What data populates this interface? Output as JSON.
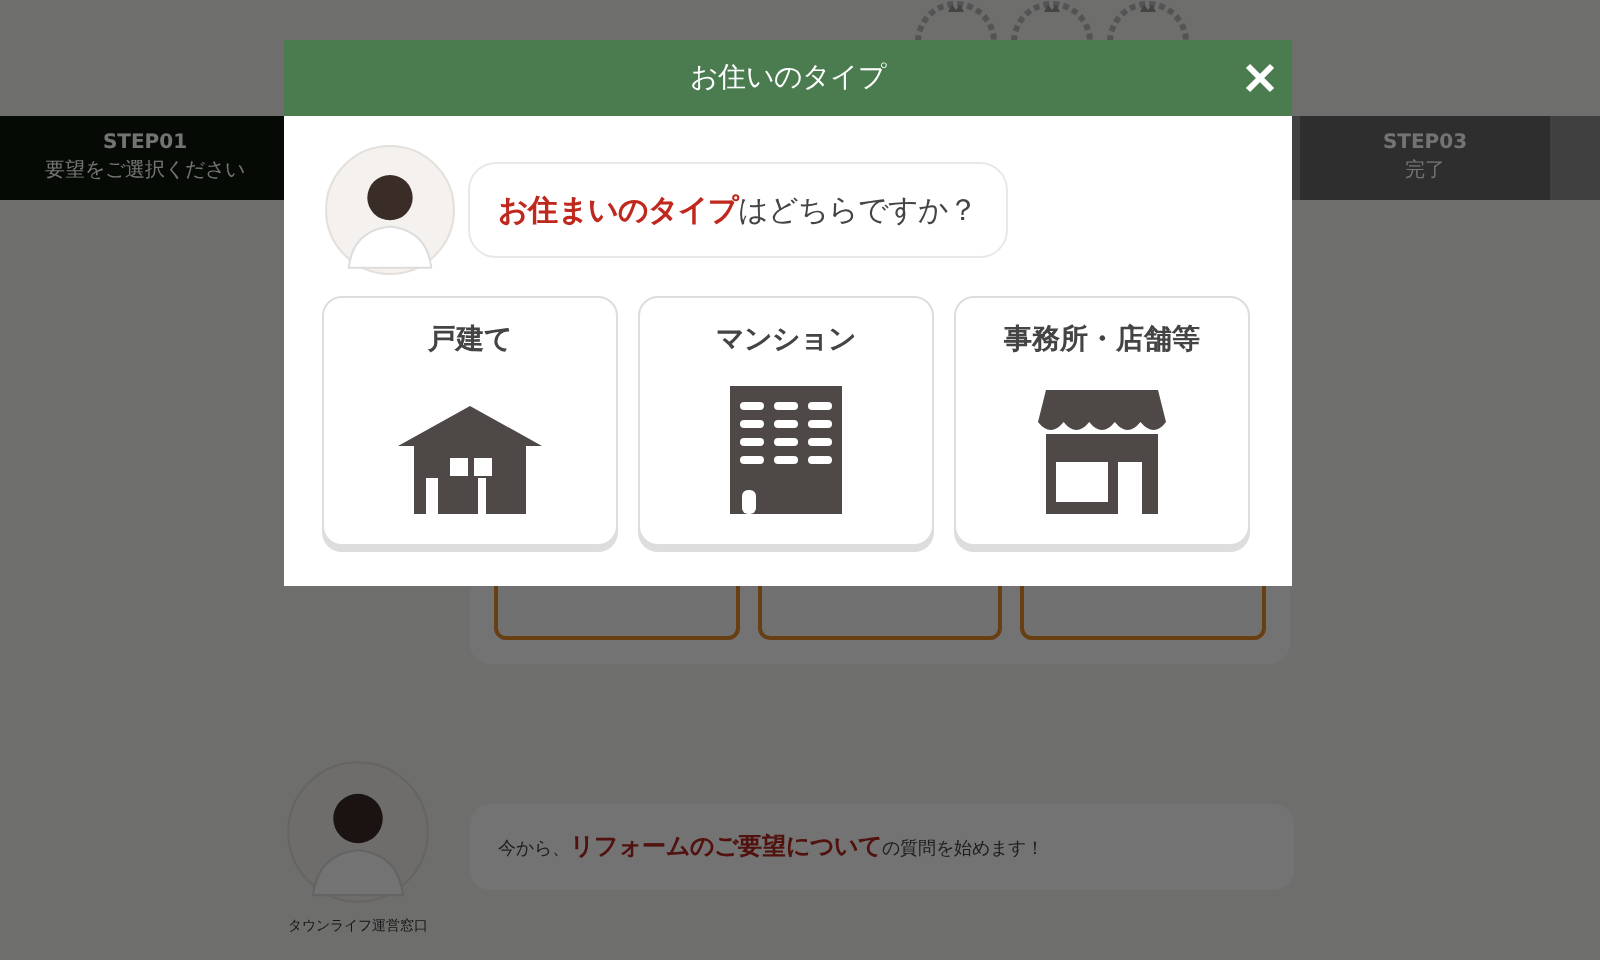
{
  "steps": [
    {
      "label": "STEP01",
      "caption": "要望をご選択ください",
      "selected": true
    },
    {
      "label": "STEP03",
      "caption": "完了",
      "selected": false
    }
  ],
  "chat": {
    "message": "今から、**リフォームのご要望について**の質問を始めます！",
    "operator": "タウンライフ運営窓口"
  },
  "modal": {
    "title": "お住いのタイプ",
    "question": "**お住まいのタイプ**はどちらですか？",
    "options": [
      {
        "label": "戸建て",
        "kind": "house"
      },
      {
        "label": "マンション",
        "kind": "building"
      },
      {
        "label": "事務所・店舗等",
        "kind": "store"
      }
    ]
  }
}
